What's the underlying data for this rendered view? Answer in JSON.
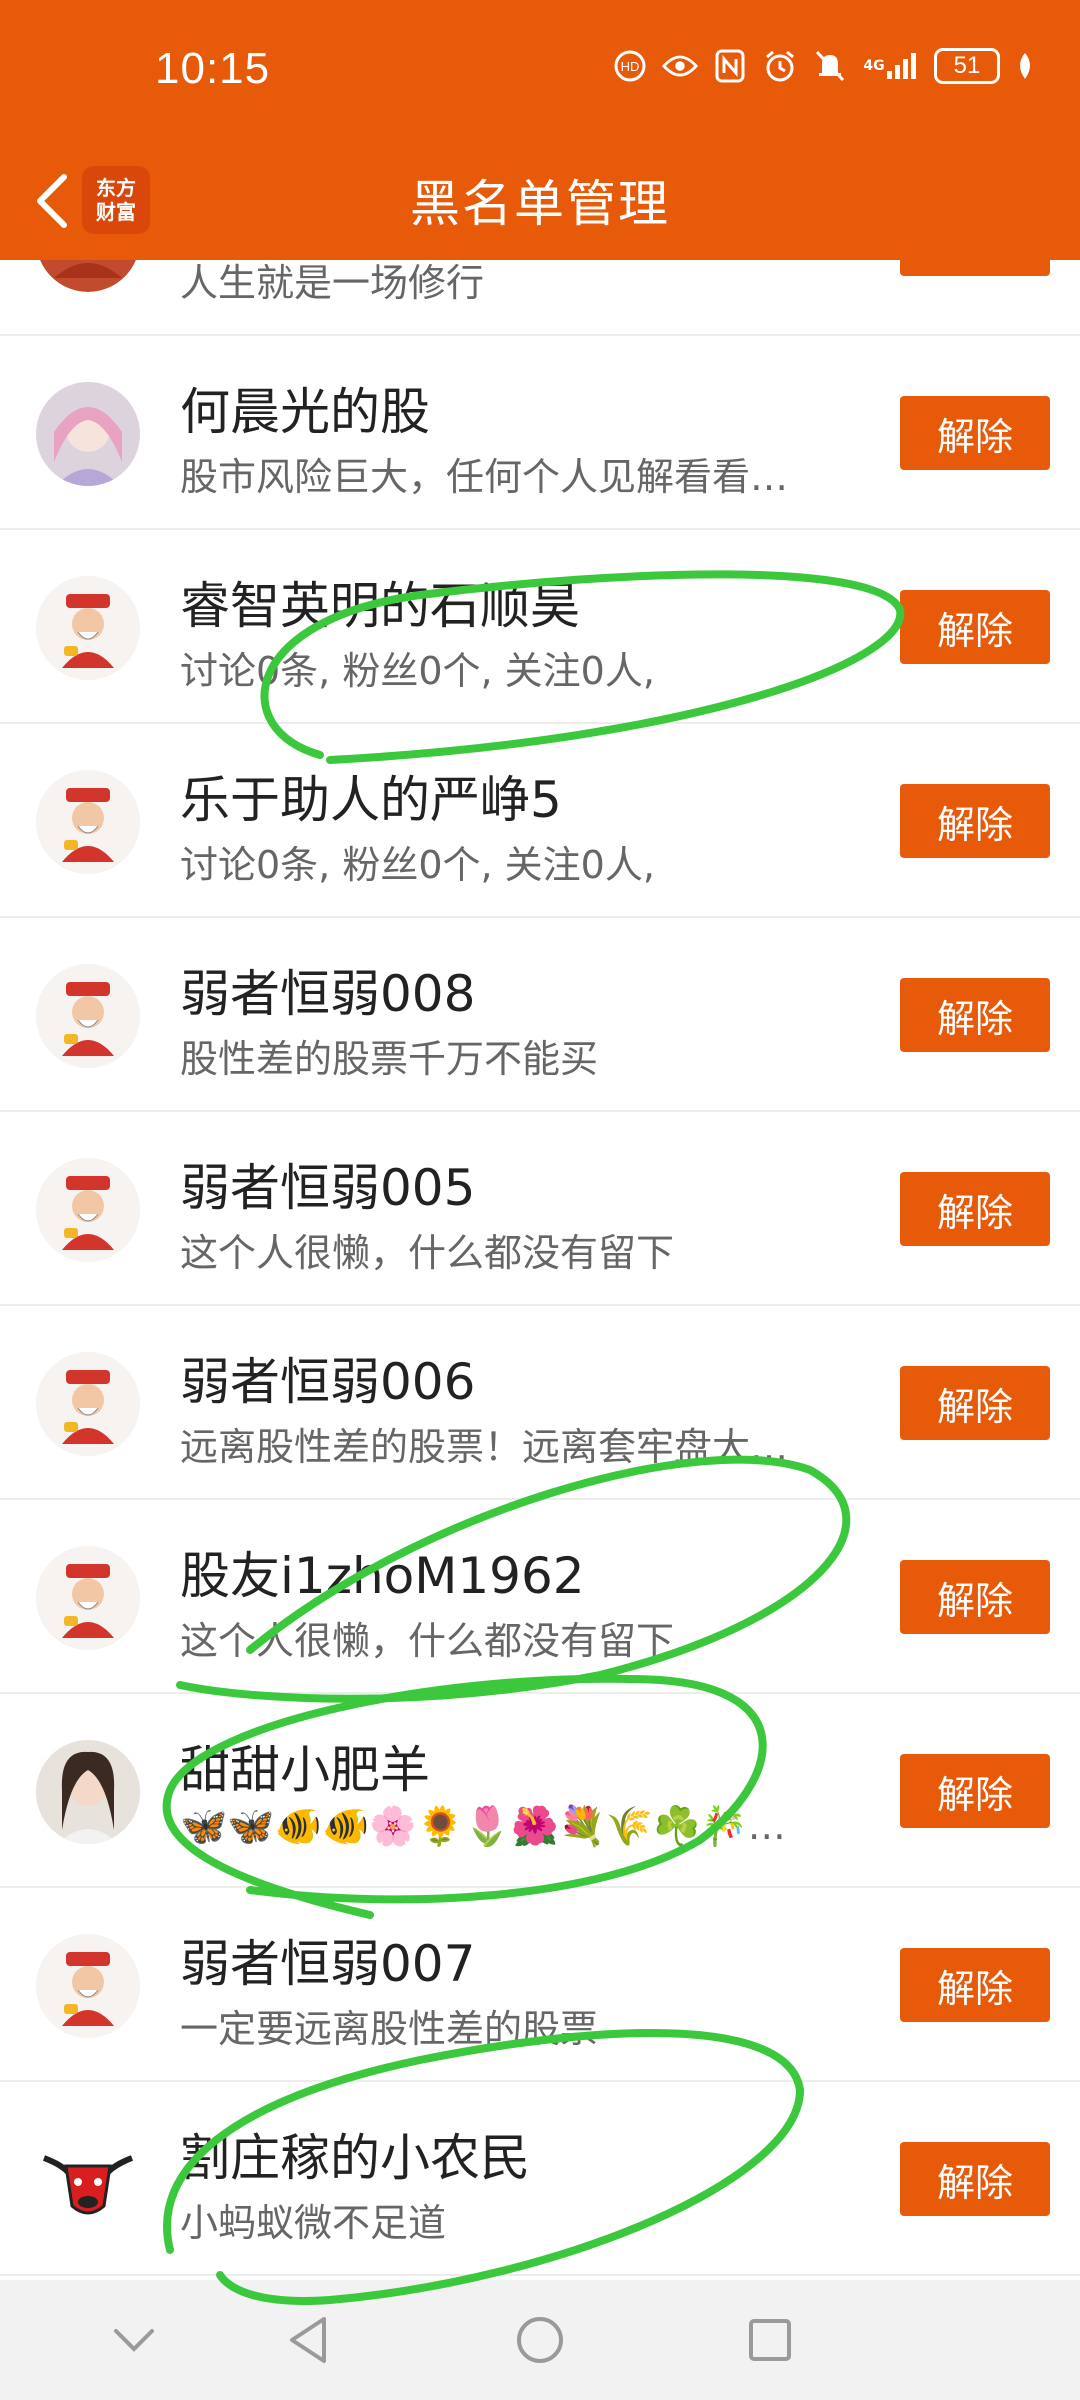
{
  "status_bar": {
    "time": "10:15",
    "network": "4G",
    "battery": "51"
  },
  "header": {
    "title": "黑名单管理",
    "logo_line1": "东方",
    "logo_line2": "财富"
  },
  "colors": {
    "brand": "#e65a0a",
    "annotation": "#3cc83c"
  },
  "list": [
    {
      "name": "",
      "desc": "人生就是一场修行",
      "button": "解除",
      "avatar": "red-figure"
    },
    {
      "name": "何晨光的股",
      "desc": "股市风险巨大，任何个人见解看看…",
      "button": "解除",
      "avatar": "anime-girl"
    },
    {
      "name": "睿智英明的石顺昊",
      "desc": "讨论0条, 粉丝0个, 关注0人,",
      "button": "解除",
      "avatar": "fortune-god"
    },
    {
      "name": "乐于助人的严峥5",
      "desc": "讨论0条, 粉丝0个, 关注0人,",
      "button": "解除",
      "avatar": "fortune-god"
    },
    {
      "name": "弱者恒弱008",
      "desc": "股性差的股票千万不能买",
      "button": "解除",
      "avatar": "fortune-god"
    },
    {
      "name": "弱者恒弱005",
      "desc": "这个人很懒，什么都没有留下",
      "button": "解除",
      "avatar": "fortune-god"
    },
    {
      "name": "弱者恒弱006",
      "desc": "远离股性差的股票！远离套牢盘大…",
      "button": "解除",
      "avatar": "fortune-god"
    },
    {
      "name": "股友i1zhoM1962",
      "desc": "这个人很懒，什么都没有留下",
      "button": "解除",
      "avatar": "fortune-god"
    },
    {
      "name": "甜甜小肥羊",
      "desc": "🦋🦋🐠🐠🌸🌻🌷🌺💐🌾☘️🎋…",
      "button": "解除",
      "avatar": "photo-girl"
    },
    {
      "name": "弱者恒弱007",
      "desc": "一定要远离股性差的股票",
      "button": "解除",
      "avatar": "fortune-god"
    },
    {
      "name": "割庄稼的小农民",
      "desc": "小蚂蚁微不足道",
      "button": "解除",
      "avatar": "red-bull"
    }
  ]
}
